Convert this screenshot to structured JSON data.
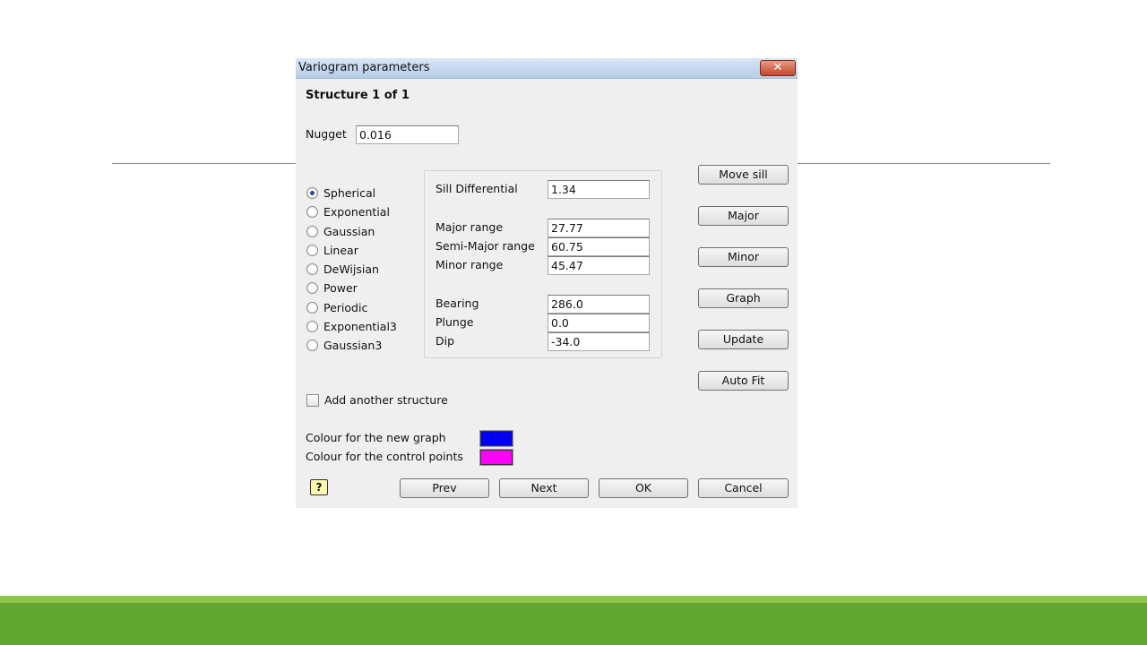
{
  "dialog": {
    "title": "Variogram parameters",
    "close_symbol": "✕",
    "structure_title": "Structure 1 of 1",
    "nugget": {
      "label": "Nugget",
      "value": "0.016"
    }
  },
  "models": {
    "selected": "Spherical",
    "options": [
      "Spherical",
      "Exponential",
      "Gaussian",
      "Linear",
      "DeWijsian",
      "Power",
      "Periodic",
      "Exponential3",
      "Gaussian3"
    ]
  },
  "params": {
    "sill": {
      "label": "Sill Differential",
      "value": "1.34"
    },
    "major": {
      "label": "Major range",
      "value": "27.77"
    },
    "semi_major": {
      "label": "Semi-Major range",
      "value": "60.75"
    },
    "minor": {
      "label": "Minor range",
      "value": "45.47"
    },
    "bearing": {
      "label": "Bearing",
      "value": "286.0"
    },
    "plunge": {
      "label": "Plunge",
      "value": "0.0"
    },
    "dip": {
      "label": "Dip",
      "value": "-34.0"
    }
  },
  "side_buttons": {
    "move_sill": "Move sill",
    "major": "Major",
    "minor": "Minor",
    "graph": "Graph",
    "update": "Update",
    "auto_fit": "Auto Fit"
  },
  "add_structure": {
    "label": "Add another structure",
    "checked": false
  },
  "colours": {
    "new_graph": {
      "label": "Colour for the new graph",
      "color": "#0000ee"
    },
    "control_points": {
      "label": "Colour for the control points",
      "color": "#ff00ff"
    }
  },
  "bottom_buttons": {
    "prev": "Prev",
    "next": "Next",
    "ok": "OK",
    "cancel": "Cancel"
  },
  "help_icon": "?"
}
